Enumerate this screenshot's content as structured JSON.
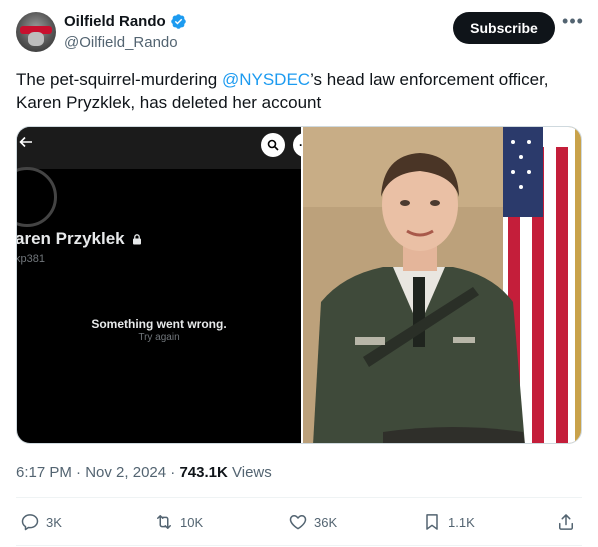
{
  "author": {
    "display_name": "Oilfield Rando",
    "handle": "@Oilfield_Rando",
    "verified": true
  },
  "header": {
    "subscribe_label": "Subscribe",
    "more_icon": "more-horizontal-icon"
  },
  "tweet": {
    "text_before": "The pet-squirrel-murdering ",
    "mention": "@NYSDEC",
    "text_after": "’s head law enforcement officer, Karen Pryzklek, has deleted her account"
  },
  "media": {
    "left": {
      "profile_name": "aren Przyklek",
      "profile_handle": "kp381",
      "error_title": "Something went wrong.",
      "error_retry": "Try again"
    },
    "right": {
      "description_icon": "portrait-photo"
    }
  },
  "meta": {
    "time": "6:17 PM",
    "date": "Nov 2, 2024",
    "views_count": "743.1K",
    "views_label": "Views"
  },
  "actions": {
    "replies": "3K",
    "reposts": "10K",
    "likes": "36K",
    "bookmarks": "1.1K"
  },
  "colors": {
    "accent": "#1d9bf0",
    "text": "#0f1419",
    "muted": "#536471"
  }
}
